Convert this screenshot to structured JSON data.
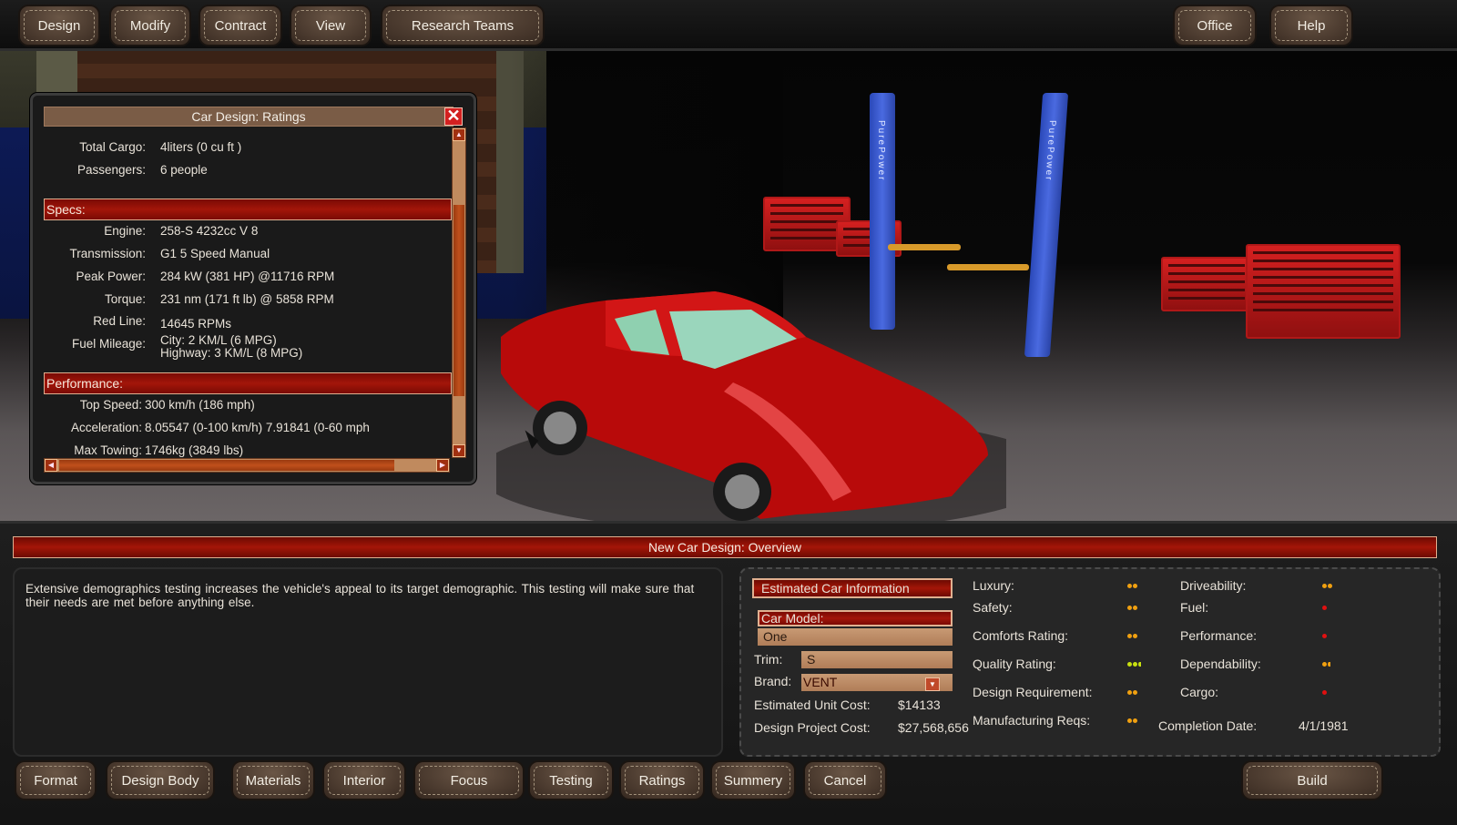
{
  "top_menu": {
    "left_buttons": [
      {
        "label": "Design"
      },
      {
        "label": "Modify"
      },
      {
        "label": "Contract"
      },
      {
        "label": "View"
      },
      {
        "label": "Research  Teams"
      }
    ],
    "right_buttons": [
      {
        "label": "Office"
      },
      {
        "label": "Help"
      }
    ]
  },
  "scene": {
    "lift_brand": "PurePower",
    "car_color": "#c80a0a"
  },
  "ratings_window": {
    "title": "Car Design:  Ratings",
    "close_icon": "✕",
    "rows_top": [
      {
        "label": "Total  Cargo:",
        "value": "4liters  (0  cu  ft )"
      },
      {
        "label": "Passengers:",
        "value": "6  people"
      }
    ],
    "specs_header": "Specs:",
    "specs": [
      {
        "label": "Engine:",
        "value": "258-S  4232cc  V  8"
      },
      {
        "label": "Transmission:",
        "value": "G1  5  Speed  Manual"
      },
      {
        "label": "Peak  Power:",
        "value": "284  kW  (381  HP)     @11716  RPM"
      },
      {
        "label": "Torque:",
        "value": "231  nm  (171  ft  lb)   @  5858  RPM"
      },
      {
        "label": "Red  Line:",
        "value": "14645  RPMs"
      },
      {
        "label": "Fuel  Mileage:",
        "value": "City:  2  KM/L  (6  MPG)",
        "value2": "Highway:  3  KM/L  (8  MPG)"
      }
    ],
    "performance_header": "Performance:",
    "performance": [
      {
        "label": "Top  Speed:",
        "value": "300  km/h  (186  mph)"
      },
      {
        "label": "Acceleration:",
        "value": "8.05547  (0-100  km/h)      7.91841  (0-60  mph"
      },
      {
        "label": "Max  Towing:",
        "value": "1746kg  (3849  lbs)"
      }
    ]
  },
  "overview": {
    "title": "New  Car  Design:  Overview",
    "description": "Extensive  demographics  testing  increases  the  vehicle's  appeal  to  its  target  demographic.  This  testing  will  make  sure  that  their  needs  are  met   before  anything  else.",
    "estimated_info": {
      "header": "Estimated  Car  Information",
      "car_model_label": "Car  Model:",
      "car_model_value": "One",
      "trim_label": "Trim:",
      "trim_value": "S",
      "brand_label": "Brand:",
      "brand_value": "VENT",
      "unit_cost_label": "Estimated  Unit  Cost:",
      "unit_cost_value": "$14133",
      "project_cost_label": "Design  Project  Cost:",
      "project_cost_value": "$27,568,656"
    },
    "ratings_left": [
      {
        "label": "Luxury:",
        "stars": 2,
        "color": "#f0a010"
      },
      {
        "label": "Safety:",
        "stars": 2,
        "color": "#f0a010"
      },
      {
        "label": "Comforts  Rating:",
        "stars": 2,
        "color": "#f0a010"
      },
      {
        "label": "Quality  Rating:",
        "stars": 2.5,
        "color": "#c8e010"
      },
      {
        "label": "Design  Requirement:",
        "stars": 2,
        "color": "#f0a010"
      },
      {
        "label": "Manufacturing  Reqs:",
        "stars": 2,
        "color": "#f0a010"
      }
    ],
    "ratings_right": [
      {
        "label": "Driveability:",
        "stars": 2,
        "color": "#f0a010"
      },
      {
        "label": "Fuel:",
        "stars": 1,
        "color": "#e01010"
      },
      {
        "label": "Performance:",
        "stars": 1,
        "color": "#e01010"
      },
      {
        "label": "Dependability:",
        "stars": 1.5,
        "color": "#f0a010"
      },
      {
        "label": "Cargo:",
        "stars": 1,
        "color": "#e01010"
      }
    ],
    "completion_label": "Completion  Date:",
    "completion_value": "4/1/1981"
  },
  "bottom_menu": {
    "buttons": [
      {
        "label": "Format"
      },
      {
        "label": "Design  Body"
      },
      {
        "label": "Materials"
      },
      {
        "label": "Interior"
      },
      {
        "label": "Focus"
      },
      {
        "label": "Testing"
      },
      {
        "label": "Ratings"
      },
      {
        "label": "Summery"
      },
      {
        "label": "Cancel"
      }
    ],
    "build_label": "Build"
  }
}
